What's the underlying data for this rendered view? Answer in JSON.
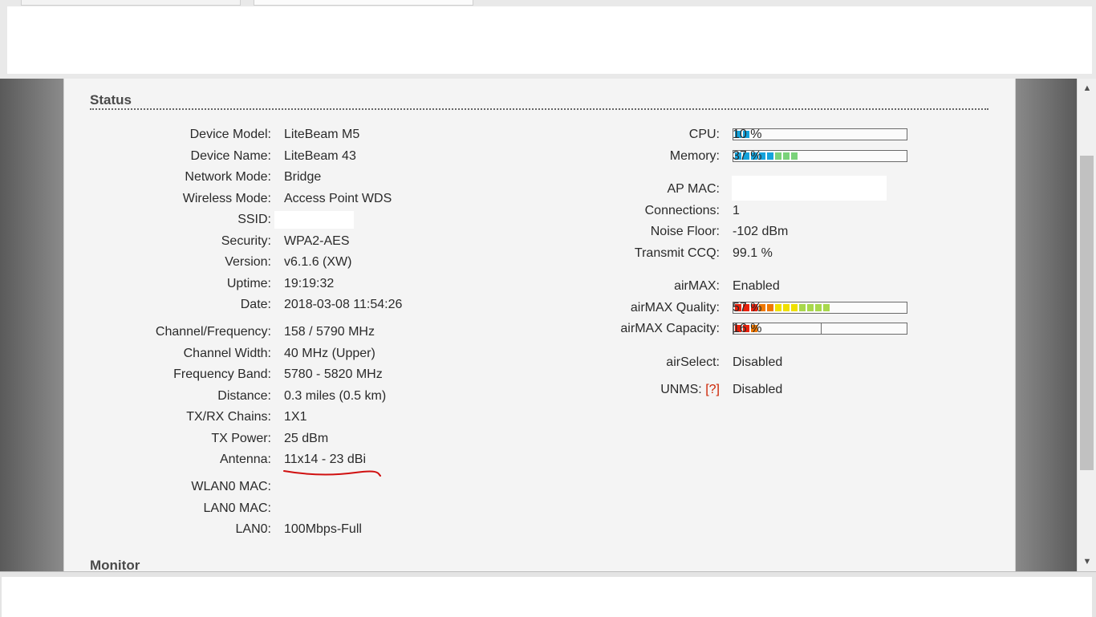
{
  "status": {
    "title": "Status",
    "left": [
      {
        "label": "Device Model:",
        "value": "LiteBeam M5"
      },
      {
        "label": "Device Name:",
        "value": "LiteBeam 43"
      },
      {
        "label": "Network Mode:",
        "value": "Bridge"
      },
      {
        "label": "Wireless Mode:",
        "value": "Access Point WDS"
      },
      {
        "label": "SSID:",
        "value": ""
      },
      {
        "label": "Security:",
        "value": "WPA2-AES"
      },
      {
        "label": "Version:",
        "value": "v6.1.6 (XW)"
      },
      {
        "label": "Uptime:",
        "value": "19:19:32"
      },
      {
        "label": "Date:",
        "value": "2018-03-08 11:54:26"
      },
      {
        "label": "Channel/Frequency:",
        "value": "158 / 5790 MHz"
      },
      {
        "label": "Channel Width:",
        "value": "40 MHz (Upper)"
      },
      {
        "label": "Frequency Band:",
        "value": "5780 - 5820 MHz"
      },
      {
        "label": "Distance:",
        "value": "0.3 miles (0.5 km)"
      },
      {
        "label": "TX/RX Chains:",
        "value": "1X1"
      },
      {
        "label": "TX Power:",
        "value": "25 dBm"
      },
      {
        "label": "Antenna:",
        "value": "11x14 - 23 dBi"
      },
      {
        "label": "WLAN0 MAC:",
        "value": ""
      },
      {
        "label": "LAN0 MAC:",
        "value": ""
      },
      {
        "label": "LAN0:",
        "value": "100Mbps-Full"
      }
    ],
    "right": {
      "cpu": {
        "label": "CPU:",
        "pct_text": "10 %",
        "fraction": 0.1
      },
      "memory": {
        "label": "Memory:",
        "pct_text": "37 %",
        "fraction": 0.37
      },
      "ap_mac": {
        "label": "AP MAC:",
        "value": ""
      },
      "connections": {
        "label": "Connections:",
        "value": "1"
      },
      "noise_floor": {
        "label": "Noise Floor:",
        "value": "-102 dBm"
      },
      "transmit_ccq": {
        "label": "Transmit CCQ:",
        "value": "99.1 %"
      },
      "airmax": {
        "label": "airMAX:",
        "value": "Enabled"
      },
      "airmax_quality": {
        "label": "airMAX Quality:",
        "pct_text": "57 %",
        "fraction": 0.57
      },
      "airmax_capacity": {
        "label": "airMAX Capacity:",
        "pct_text": "16 %",
        "fraction": 0.16
      },
      "airselect": {
        "label": "airSelect:",
        "value": "Disabled"
      },
      "unms": {
        "label": "UNMS:",
        "help": "[?]",
        "value": "Disabled"
      }
    }
  },
  "monitor": {
    "title": "Monitor"
  },
  "colors": {
    "bar_blue": "#14a3dc",
    "bar_green": "#7ad27a",
    "quality_red": "#e8200a",
    "quality_orange": "#f07800",
    "quality_yellow": "#f0e000",
    "quality_lightgreen": "#a8d84c",
    "annotation_red": "#d01010"
  }
}
